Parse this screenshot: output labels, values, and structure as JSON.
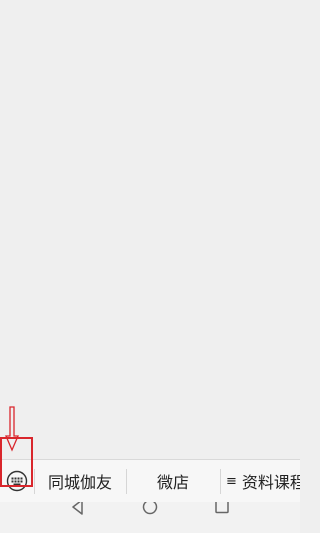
{
  "menu": {
    "keyboard_toggle_icon": "keyboard-icon",
    "items": [
      {
        "label": "同城伽友"
      },
      {
        "label": "微店"
      },
      {
        "label": "资料课程",
        "icon": "list-icon",
        "glyph": "≡"
      }
    ]
  },
  "annotation": {
    "color": "#d9262c",
    "arrow": "down-arrow",
    "highlight": "keyboard-toggle"
  },
  "nav": {
    "buttons": [
      "back-icon",
      "home-icon",
      "recent-apps-icon"
    ]
  }
}
